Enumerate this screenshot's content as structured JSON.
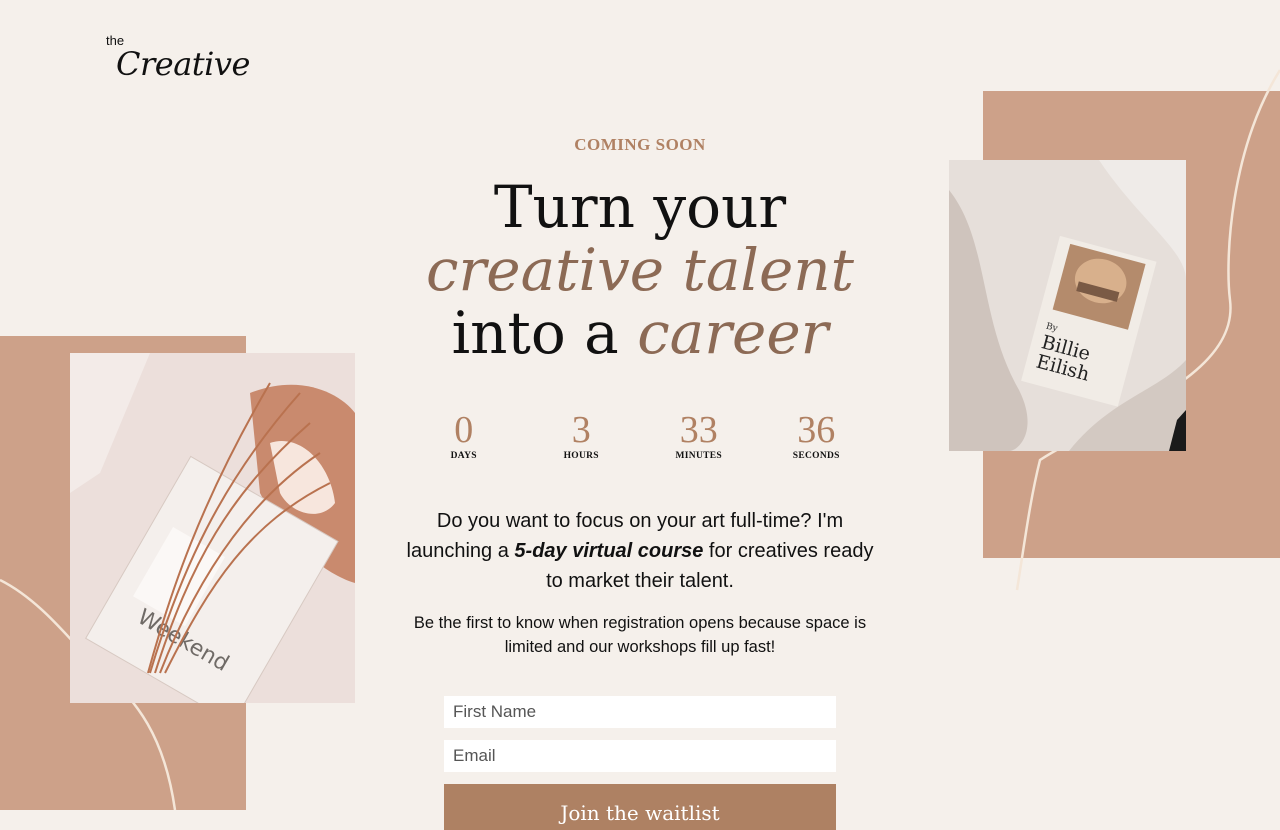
{
  "logo": {
    "small": "the",
    "big": "Creative"
  },
  "hero": {
    "eyebrow": "COMING SOON",
    "line1": "Turn your",
    "line2": "creative talent",
    "line3_plain": "into a ",
    "line3_accent": "career"
  },
  "countdown": [
    {
      "value": "0",
      "label": "DAYS"
    },
    {
      "value": "3",
      "label": "HOURS"
    },
    {
      "value": "33",
      "label": "MINUTES"
    },
    {
      "value": "36",
      "label": "SECONDS"
    }
  ],
  "intro": {
    "before": "Do you want to focus on your art full-time? I'm launching a ",
    "emphasis": "5-day virtual course",
    "after": " for creatives ready to market their talent."
  },
  "sub": "Be the first to know when registration opens because space is limited and our workshops fill up fast!",
  "form": {
    "first_name_placeholder": "First Name",
    "email_placeholder": "Email",
    "submit_label": "Join the waitlist"
  },
  "photos": {
    "left_magazine_text": "Weekend",
    "right_book_line1": "By",
    "right_book_line2": "Billie",
    "right_book_line3": "Eilish"
  },
  "colors": {
    "accent": "#b08163",
    "block": "#cda189",
    "background": "#f5f0eb",
    "button": "#ae8163"
  }
}
